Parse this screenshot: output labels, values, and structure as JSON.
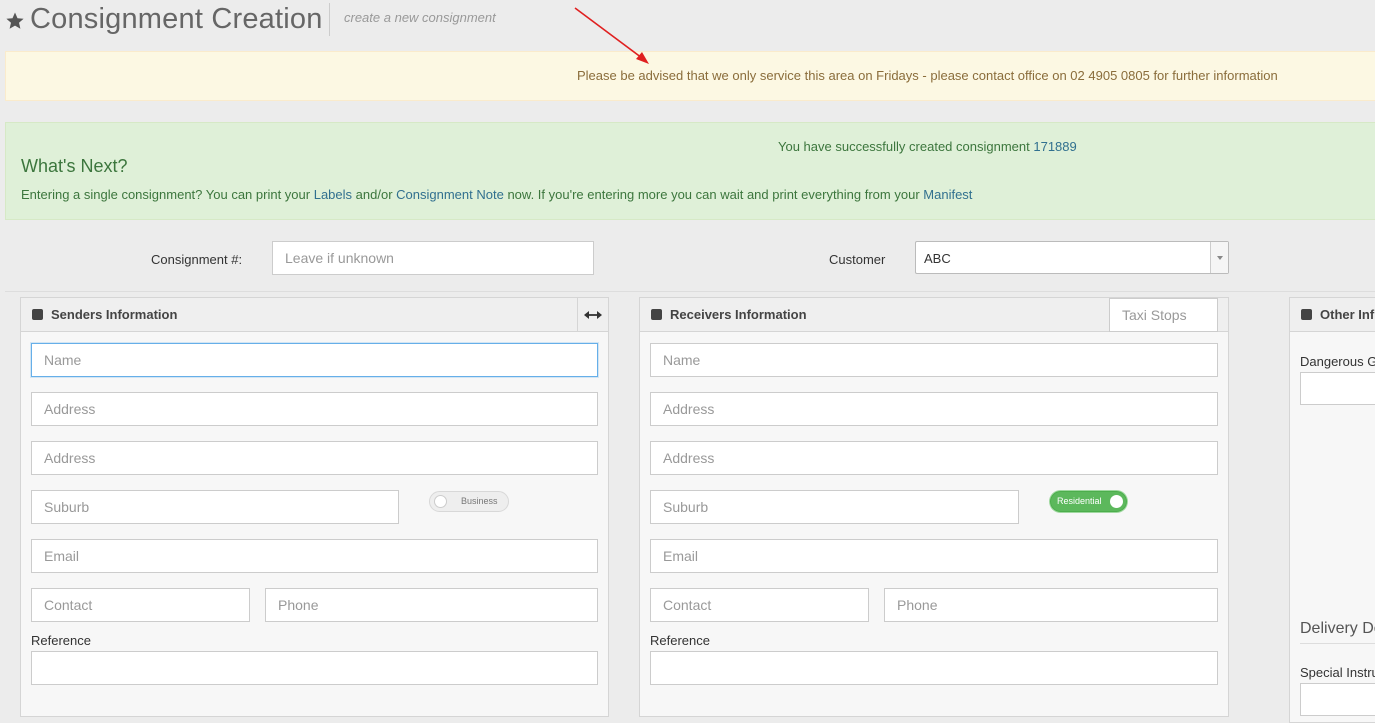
{
  "header": {
    "title": "Consignment Creation",
    "subtitle": "create a new consignment"
  },
  "alerts": {
    "warning": "Please be advised that we only service this area on Fridays - please contact office on 02 4905 0805 for further information",
    "success_prefix": "You have successfully created consignment",
    "consignment_number": "171889",
    "next_heading": "What's Next?",
    "next_text_1": "Entering a single consignment? You can print your",
    "labels_link": "Labels",
    "next_text_2": "and/or",
    "note_link": "Consignment Note",
    "next_text_3": "now. If you're entering more you can wait and print everything from your",
    "manifest_link": "Manifest"
  },
  "top_form": {
    "consignment_label": "Consignment #:",
    "consignment_placeholder": "Leave if unknown",
    "customer_label": "Customer",
    "customer_value": "ABC"
  },
  "senders": {
    "title": "Senders Information",
    "name_placeholder": "Name",
    "address1_placeholder": "Address",
    "address2_placeholder": "Address",
    "suburb_placeholder": "Suburb",
    "toggle_label": "Business",
    "email_placeholder": "Email",
    "contact_placeholder": "Contact",
    "phone_placeholder": "Phone",
    "reference_label": "Reference"
  },
  "receivers": {
    "title": "Receivers Information",
    "taxi_stops_placeholder": "Taxi Stops",
    "name_placeholder": "Name",
    "address1_placeholder": "Address",
    "address2_placeholder": "Address",
    "suburb_placeholder": "Suburb",
    "toggle_label": "Residential",
    "email_placeholder": "Email",
    "contact_placeholder": "Contact",
    "phone_placeholder": "Phone",
    "reference_label": "Reference"
  },
  "other": {
    "title": "Other Inf",
    "dangerous_goods_label": "Dangerous G",
    "delivery_heading": "Delivery De",
    "special_instructions_label": "Special Instru"
  },
  "colors": {
    "warning_bg": "#fcf8e3",
    "success_bg": "#dff0d8",
    "link": "#31708f",
    "toggle_on": "#5cb85c",
    "arrow": "#e02020"
  }
}
